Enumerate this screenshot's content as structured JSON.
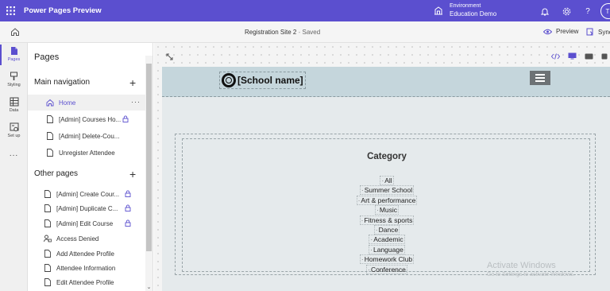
{
  "topbar": {
    "app_title": "Power Pages Preview",
    "environment_label": "Environment",
    "environment_name": "Education Demo",
    "avatar_initials": "TI"
  },
  "subbar": {
    "site_name": "Registration Site 2",
    "separator": " - ",
    "status": "Saved",
    "preview_label": "Preview",
    "sync_label": "Sync"
  },
  "rail": {
    "items": [
      {
        "label": "Pages",
        "icon": "page-icon"
      },
      {
        "label": "Styling",
        "icon": "paint-brush-icon"
      },
      {
        "label": "Data",
        "icon": "table-icon"
      },
      {
        "label": "Set up",
        "icon": "setup-icon"
      }
    ],
    "more_label": "..."
  },
  "panel": {
    "title": "Pages",
    "main_nav_title": "Main navigation",
    "other_pages_title": "Other pages",
    "main_nav_items": [
      {
        "label": "Home",
        "locked": false
      },
      {
        "label": "[Admin] Courses Ho...",
        "locked": true
      },
      {
        "label": "[Admin] Delete-Cou...",
        "locked": false
      },
      {
        "label": "Unregister Attendee",
        "locked": false
      }
    ],
    "other_items": [
      {
        "label": "[Admin] Create Cour...",
        "locked": true
      },
      {
        "label": "[Admin] Duplicate C...",
        "locked": true
      },
      {
        "label": "[Admin] Edit Course",
        "locked": true
      },
      {
        "label": "Access Denied",
        "locked": false
      },
      {
        "label": "Add Attendee Profile",
        "locked": false
      },
      {
        "label": "Attendee Information",
        "locked": false
      },
      {
        "label": "Edit Attendee Profile",
        "locked": false
      }
    ],
    "more_dots": "···"
  },
  "site": {
    "school_name": "[School name]",
    "category_title": "Category",
    "categories": [
      "All",
      "Summer School",
      "Art & performance",
      "Music",
      "Fitness & sports",
      "Dance",
      "Academic",
      "Language",
      "Homework Club",
      "Conference"
    ]
  },
  "watermark": {
    "title": "Activate Windows",
    "subtitle": "Go to Settings to activate Windows."
  },
  "colors": {
    "brand": "#5b4fcf",
    "site_header": "#c5d6dc",
    "site_body": "#e5eaec"
  }
}
